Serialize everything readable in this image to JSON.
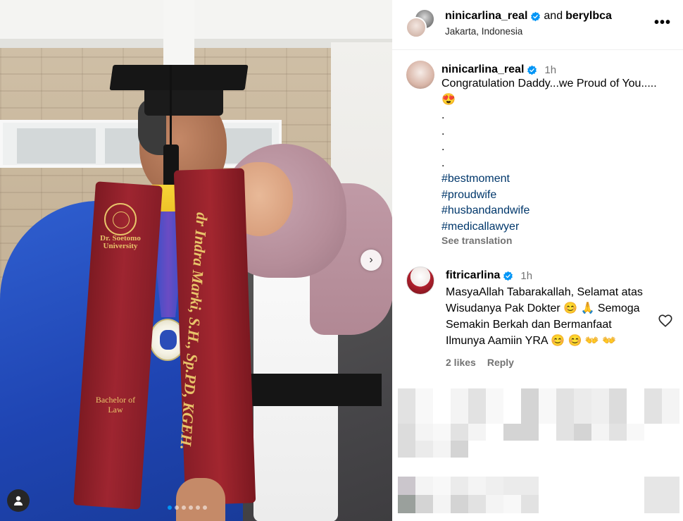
{
  "header": {
    "user1": "ninicarlina_real",
    "and_text": "and",
    "user2": "berylbca",
    "location": "Jakarta, Indonesia",
    "more_label": "•••"
  },
  "photo": {
    "stole_university": "Dr. Soetomo University",
    "stole_degree": "Bachelor of Law",
    "stole_name": "dr Indra Marki, S.H., Sp.PD, KGEH.",
    "next_label": "›",
    "slide_count": 6,
    "active_slide": 1
  },
  "caption": {
    "username": "ninicarlina_real",
    "time": "1h",
    "text": "Congratulation Daddy...we Proud of You.....",
    "emoji": "😍",
    "dots": [
      ".",
      ".",
      ".",
      "."
    ],
    "hashtags": [
      "#bestmoment",
      "#proudwife",
      "#husbandandwife",
      "#medicallawyer"
    ],
    "see_translation": "See translation"
  },
  "comment": {
    "username": "fitricarlina",
    "time": "1h",
    "text": "MasyaAllah Tabarakallah, Selamat atas Wisudanya Pak Dokter 😊 🙏 Semoga Semakin Berkah dan Bermanfaat Ilmunya Aamiin YRA 😊 😊 👐 👐",
    "likes": "2 likes",
    "reply": "Reply"
  },
  "colors": {
    "verified": "#0095f6",
    "hashtag": "#00376b",
    "muted": "#737373"
  },
  "icons": {
    "verified": "verified-badge-icon",
    "heart": "heart-outline-icon",
    "more": "more-horizontal-icon",
    "next": "chevron-right-icon",
    "user_tag": "user-tag-icon"
  }
}
